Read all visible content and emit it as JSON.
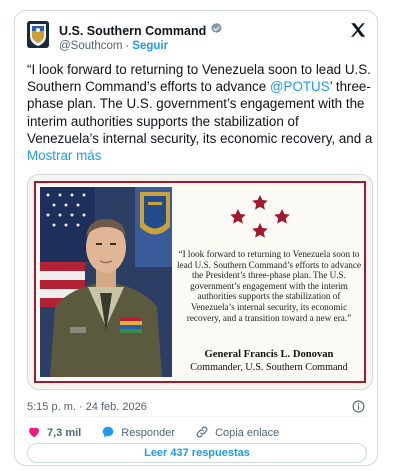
{
  "account": {
    "name": "U.S. Southern Command",
    "handle": "@Southcom",
    "separator": "·",
    "follow_label": "Seguir"
  },
  "tweet": {
    "text_before_mention": "“I look forward to returning to Venezuela soon to lead U.S. Southern Command’s efforts to advance ",
    "mention": "@POTUS",
    "text_after_mention": "’ three-phase plan. The U.S. government’s engagement with the interim authorities supports the stabilization of Venezuela’s internal security, its economic recovery, and a",
    "show_more": "Mostrar más"
  },
  "media": {
    "quote": "“I look forward to returning to Venezuela soon to lead U.S. Southern Command’s efforts to advance the President’s three-phase plan. The U.S. government’s engagement with the interim authorities supports the stabilization of Venezuela’s internal security, its economic recovery, and a transition toward a new era.”",
    "signature_name": "General Francis L. Donovan",
    "signature_title": "Commander, U.S. Southern Command"
  },
  "meta": {
    "timestamp": "5:15 p. m. · 24 feb. 2026"
  },
  "actions": {
    "likes": "7,3 mil",
    "reply_label": "Responder",
    "copy_link_label": "Copia enlace"
  },
  "replies_button": "Leer 437 respuestas",
  "colors": {
    "accent": "#1d9bf0",
    "like": "#f91880",
    "frame_red": "#a3192d",
    "muted": "#536471"
  },
  "icons": [
    "southcom-seal-icon",
    "verified-badge-icon",
    "x-logo-icon",
    "info-icon",
    "heart-icon",
    "reply-bubble-icon",
    "link-icon",
    "star-icon"
  ]
}
